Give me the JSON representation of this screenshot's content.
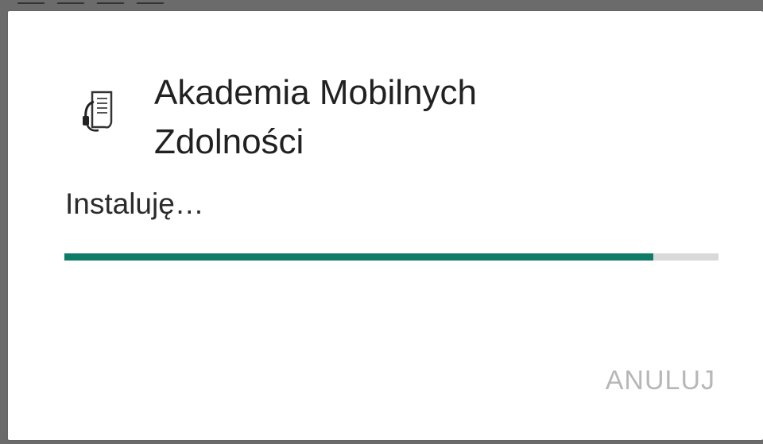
{
  "dialog": {
    "app_name": "Akademia Mobilnych Zdolności",
    "status": "Instaluję…",
    "progress_fraction": 0.9,
    "cancel_label": "ANULUJ",
    "icon": "app-icon-document-headset"
  },
  "colors": {
    "progress": "#0e7c66",
    "track": "#d9d9d9",
    "button_disabled": "#b7b7b7",
    "title": "#212121"
  }
}
